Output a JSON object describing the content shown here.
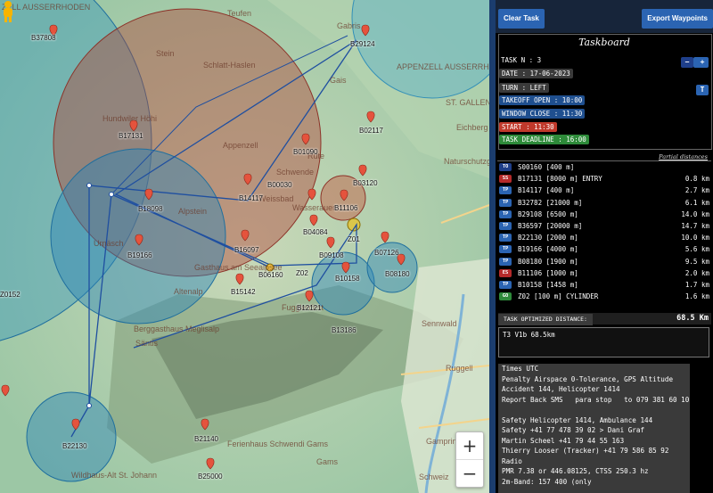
{
  "map": {
    "places": [
      "ZELL AUSSERRHODEN",
      "Teufen",
      "Stein",
      "Schlatt-Haslen",
      "Appenzell",
      "Gais",
      "Gabris",
      "Schwende",
      "Rüte",
      "Weissbad",
      "Wasserauen",
      "Alpstein",
      "Säntis",
      "Altenalp",
      "Fugglenfirst",
      "Sennwald",
      "Ruggell",
      "Gams",
      "Gamprin",
      "Eichberg",
      "Naturschutzgebiet",
      "Wildhaus-Alt St. Johann",
      "Hundwiler Höhi",
      "Ferienhaus Schwendi Gams",
      "Urnäsch",
      "APPENZELL AUSSERRHODEN",
      "ST. GALLEN",
      "Berggasthaus Meglisalp",
      "Gasthaus am Seealpsee",
      "Schweiz"
    ],
    "waypoints": [
      "B37808",
      "B29124",
      "B17131",
      "B01090",
      "B02117",
      "B18098",
      "B14117",
      "B00030",
      "B03120",
      "B11106",
      "B04084",
      "B19166",
      "B16097",
      "B06160",
      "B09108",
      "B07126",
      "Z02",
      "Z01",
      "B10158",
      "B08180",
      "B15142",
      "B12121",
      "B13186",
      "B22130",
      "B21140",
      "B25000",
      "Z0152"
    ],
    "zoom_in": "+",
    "zoom_out": "−",
    "pegman_icon": "pegman-icon"
  },
  "toolbar": {
    "clear_task": "Clear Task",
    "export_waypoints": "Export Waypoints"
  },
  "taskboard": {
    "title": "Taskboard",
    "task_n": "TASK N : 3",
    "date": "DATE : 17-06-2023",
    "turn": "TURN : LEFT",
    "takeoff_open": "TAKEOFF OPEN : 10:00",
    "window_close": "WINDOW CLOSE : 11:30",
    "start": "START : 11:30",
    "task_deadline": "TASK DEADLINE : 16:00",
    "minus": "-",
    "plus": "+",
    "t_button": "T",
    "partial_distances": "Partial distances"
  },
  "turnpoints": [
    {
      "tag": "TO",
      "name": "S00160 [400 m]",
      "dist": "",
      "color": "#1f3f8a"
    },
    {
      "tag": "SS",
      "name": "B17131 [8000 m] ENTRY",
      "dist": "0.8 km",
      "color": "#b52a2a"
    },
    {
      "tag": "TP",
      "name": "B14117 [400 m]",
      "dist": "2.7 km",
      "color": "#2b64b2"
    },
    {
      "tag": "TP",
      "name": "B32782 [21000 m]",
      "dist": "6.1 km",
      "color": "#2b64b2"
    },
    {
      "tag": "TP",
      "name": "B29108 [6500 m]",
      "dist": "14.0 km",
      "color": "#2b64b2"
    },
    {
      "tag": "TP",
      "name": "B36597 [20000 m]",
      "dist": "14.7 km",
      "color": "#2b64b2"
    },
    {
      "tag": "TP",
      "name": "B22130 [2000 m]",
      "dist": "10.0 km",
      "color": "#2b64b2"
    },
    {
      "tag": "TP",
      "name": "B19166 [4000 m]",
      "dist": "5.6 km",
      "color": "#2b64b2"
    },
    {
      "tag": "TP",
      "name": "B08180 [1900 m]",
      "dist": "9.5 km",
      "color": "#2b64b2"
    },
    {
      "tag": "ES",
      "name": "B11106 [1000 m]",
      "dist": "2.0 km",
      "color": "#b52a2a"
    },
    {
      "tag": "TP",
      "name": "B10158 [1458 m]",
      "dist": "1.7 km",
      "color": "#2b64b2"
    },
    {
      "tag": "GO",
      "name": "Z02 [100 m] CYLINDER",
      "dist": "1.6 km",
      "color": "#2e8b3a"
    }
  ],
  "optimized": {
    "label": "TASK OPTIMIZED DISTANCE:",
    "value": "68.5 Km"
  },
  "task_code": "T3 V1b 68.5km",
  "notes": "Times UTC\nPenalty Airspace 0-Tolerance, GPS Altitude\nAccident 144, Helicopter 1414\nReport Back SMS   para stop   to 079 381 60 10\n\nSafety Helicopter 1414, Ambulance 144\nSafety +41 77 478 39 02 > Dani Graf\nMartin Scheel +41 79 44 55 163\nThierry Looser (Tracker) +41 79 586 85 92\nRadio\nPMR 7.38 or 446.08125, CTSS 250.3 hz\n2m-Band: 157 400 (only",
  "colors": {
    "panel_bg": "#000000",
    "button_blue": "#2b64b2",
    "red_chip": "#c0392b",
    "green_chip": "#2e8b3a",
    "blue_chip": "#1f4f8f"
  }
}
